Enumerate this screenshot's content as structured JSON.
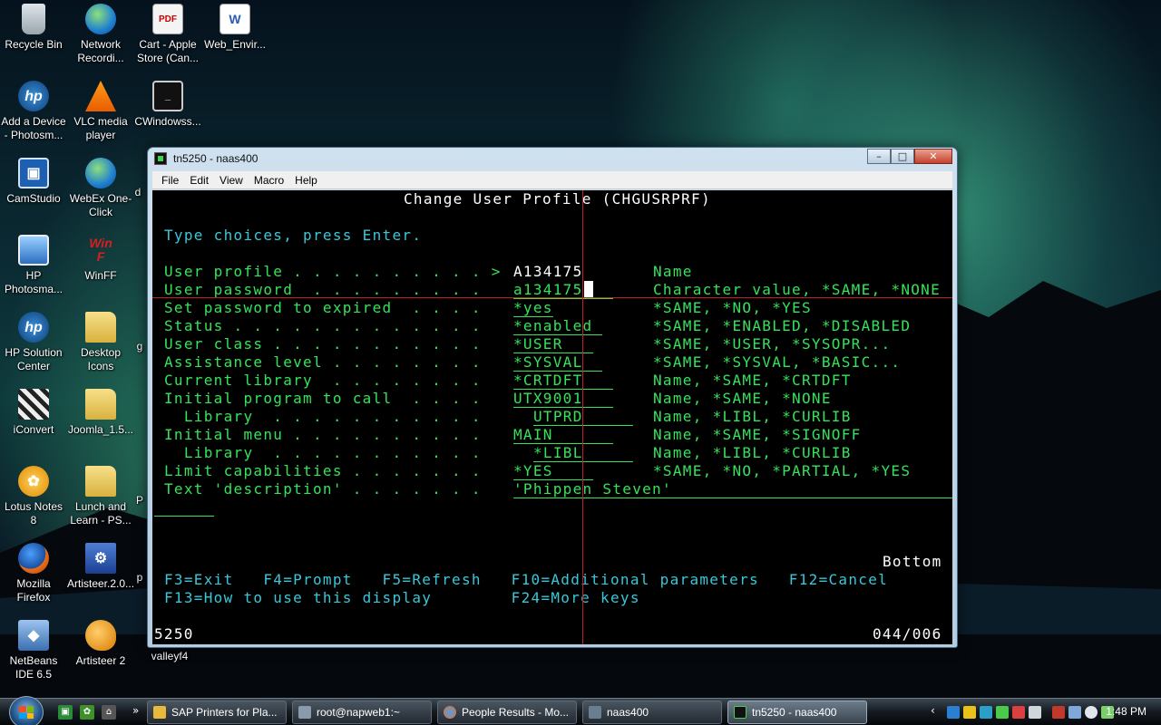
{
  "desktop": {
    "icons": [
      {
        "label": "Recycle Bin",
        "icon": "recycle-bin-icon"
      },
      {
        "label": "Network Recordi...",
        "icon": "network-recorder-icon"
      },
      {
        "label": "Cart - Apple Store (Can...",
        "icon": "pdf-icon"
      },
      {
        "label": "Web_Envir...",
        "icon": "word-doc-icon"
      },
      {
        "label": "Add a Device - Photosm...",
        "icon": "hp-icon"
      },
      {
        "label": "VLC media player",
        "icon": "vlc-icon"
      },
      {
        "label": "CWindowss...",
        "icon": "console-icon"
      },
      {
        "label": "CamStudio",
        "icon": "camstudio-icon"
      },
      {
        "label": "WebEx One-Click",
        "icon": "webex-icon"
      },
      {
        "label": "HP Photosma...",
        "icon": "hp-photosmart-icon"
      },
      {
        "label": "WinFF",
        "icon": "winff-icon"
      },
      {
        "label": "HP Solution Center",
        "icon": "hp-solution-icon"
      },
      {
        "label": "Desktop Icons",
        "icon": "folder-icon"
      },
      {
        "label": "iConvert",
        "icon": "iconvert-icon"
      },
      {
        "label": "Joomla_1.5...",
        "icon": "folder-icon"
      },
      {
        "label": "Lotus Notes 8",
        "icon": "lotus-notes-icon"
      },
      {
        "label": "Lunch and Learn - PS...",
        "icon": "folder-icon"
      },
      {
        "label": "Mozilla Firefox",
        "icon": "firefox-icon"
      },
      {
        "label": "Artisteer.2.0...",
        "icon": "artisteer-installer-icon"
      },
      {
        "label": "NetBeans IDE 6.5",
        "icon": "netbeans-icon"
      },
      {
        "label": "Artisteer 2",
        "icon": "artisteer-icon"
      },
      {
        "label": "valleyf4",
        "icon": ""
      }
    ],
    "partial_labels": [
      "d",
      "g",
      "P",
      "p"
    ]
  },
  "window": {
    "title": "tn5250 - naas400",
    "buttons": {
      "minimize": "–",
      "maximize": "□",
      "close": "✕"
    },
    "menu": [
      "File",
      "Edit",
      "View",
      "Macro",
      "Help"
    ]
  },
  "screen": {
    "heading": "Change User Profile (CHGUSRPRF)",
    "instruction": "Type choices, press Enter.",
    "fields": [
      {
        "label": "User profile . . . . . . . . . . >",
        "value": "A134175",
        "hint": "Name"
      },
      {
        "label": "User password  . . . . . . . . .",
        "value": "a134175",
        "hint": "Character value, *SAME, *NONE"
      },
      {
        "label": "Set password to expired  . . . .",
        "value": "*yes",
        "hint": "*SAME, *NO, *YES"
      },
      {
        "label": "Status . . . . . . . . . . . . .",
        "value": "*enabled",
        "hint": "*SAME, *ENABLED, *DISABLED"
      },
      {
        "label": "User class . . . . . . . . . . .",
        "value": "*USER",
        "hint": "*SAME, *USER, *SYSOPR..."
      },
      {
        "label": "Assistance level . . . . . . . .",
        "value": "*SYSVAL",
        "hint": "*SAME, *SYSVAL, *BASIC..."
      },
      {
        "label": "Current library  . . . . . . . .",
        "value": "*CRTDFT",
        "hint": "Name, *SAME, *CRTDFT"
      },
      {
        "label": "Initial program to call  . . . .",
        "value": "UTX9001",
        "hint": "Name, *SAME, *NONE"
      },
      {
        "label": "  Library  . . . . . . . . . . .",
        "value": "UTPRD",
        "hint": "Name, *LIBL, *CURLIB"
      },
      {
        "label": "Initial menu . . . . . . . . . .",
        "value": "MAIN",
        "hint": "Name, *SAME, *SIGNOFF"
      },
      {
        "label": "  Library  . . . . . . . . . . .",
        "value": "*LIBL",
        "hint": "Name, *LIBL, *CURLIB"
      },
      {
        "label": "Limit capabilities . . . . . . .",
        "value": "*YES",
        "hint": "*SAME, *NO, *PARTIAL, *YES"
      },
      {
        "label": "Text 'description' . . . . . . .",
        "value": "'Phippen Steven'",
        "hint": ""
      }
    ],
    "more_indicator": "Bottom",
    "fkeys_line1": "F3=Exit   F4=Prompt   F5=Refresh   F10=Additional parameters   F12=Cancel",
    "fkeys_line2": "F13=How to use this display        F24=More keys",
    "status_left": "5250",
    "status_right": "044/006"
  },
  "taskbar": {
    "tasks": [
      {
        "label": "SAP Printers for Pla..."
      },
      {
        "label": "root@napweb1:~"
      },
      {
        "label": "People Results - Mo..."
      },
      {
        "label": "naas400"
      },
      {
        "label": "tn5250 - naas400"
      }
    ],
    "overflow": "»",
    "tray_chevron": "‹",
    "clock": "1:48 PM"
  },
  "colors": {
    "screen_bg": "#000000",
    "field_green": "#35e35a",
    "text_cyan": "#39c7d9",
    "text_white": "#ffffff",
    "crosshair": "#c02020"
  }
}
